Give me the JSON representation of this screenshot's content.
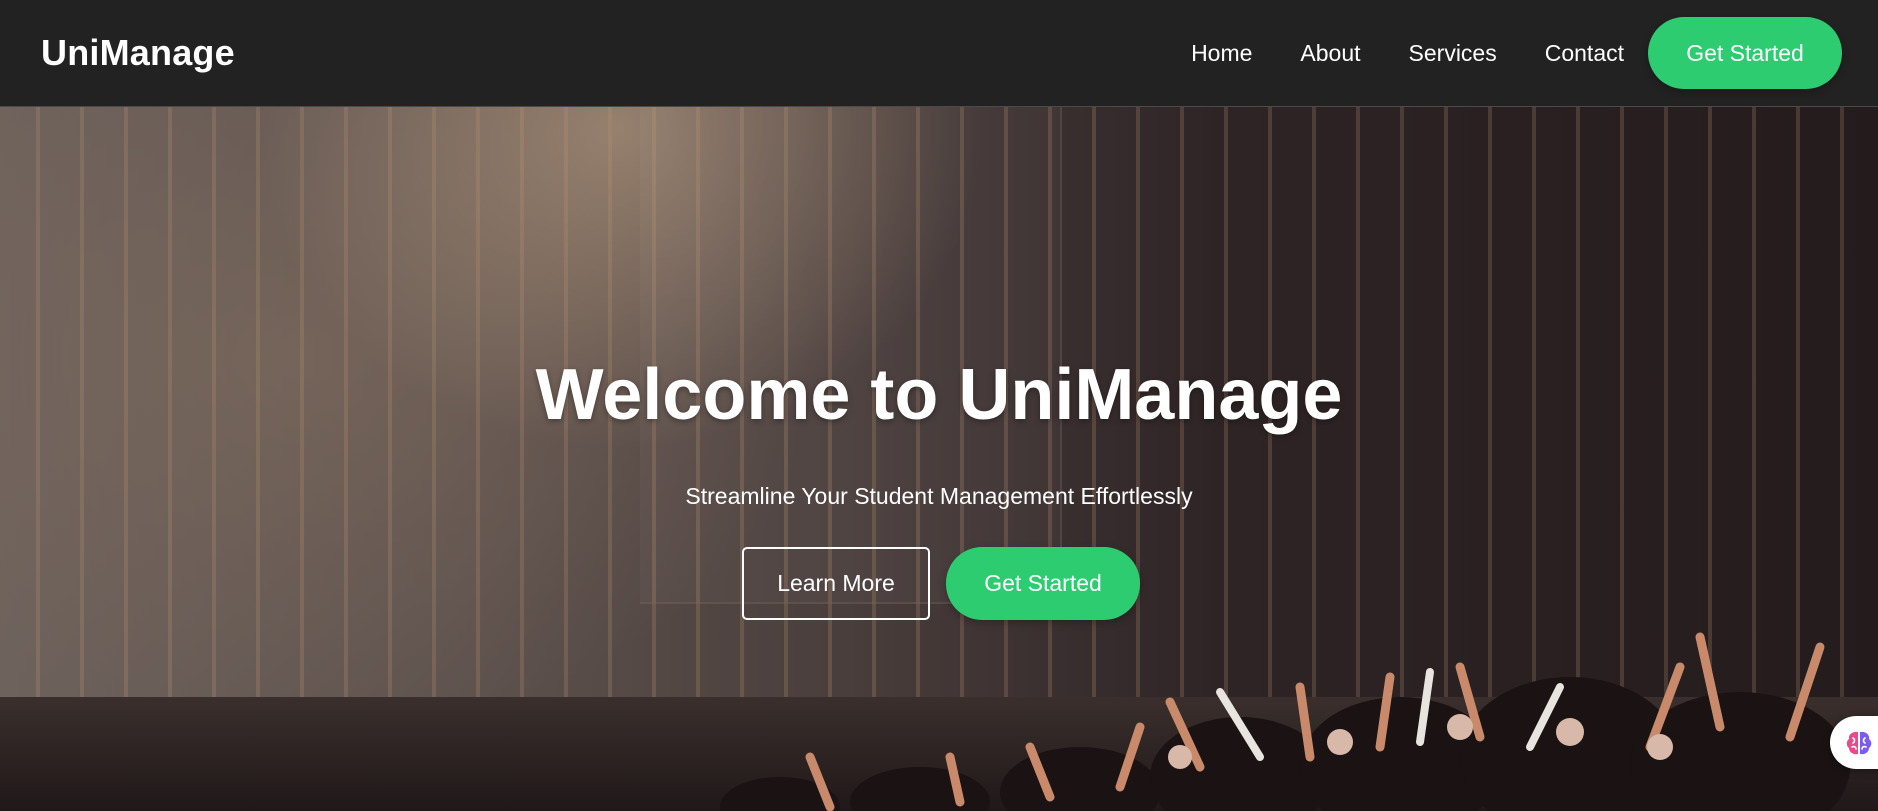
{
  "navbar": {
    "brand": "UniManage",
    "links": [
      {
        "label": "Home"
      },
      {
        "label": "About"
      },
      {
        "label": "Services"
      },
      {
        "label": "Contact"
      }
    ],
    "cta_label": "Get Started"
  },
  "hero": {
    "title": "Welcome to UniManage",
    "subtitle": "Streamline Your Student Management Effortlessly",
    "learn_more_label": "Learn More",
    "cta_label": "Get Started",
    "background": "concert-crowd-photo"
  },
  "floating_widget": {
    "icon": "brain-icon"
  },
  "colors": {
    "navbar_bg": "#222222",
    "accent_green": "#2ecc71",
    "text": "#ffffff"
  }
}
